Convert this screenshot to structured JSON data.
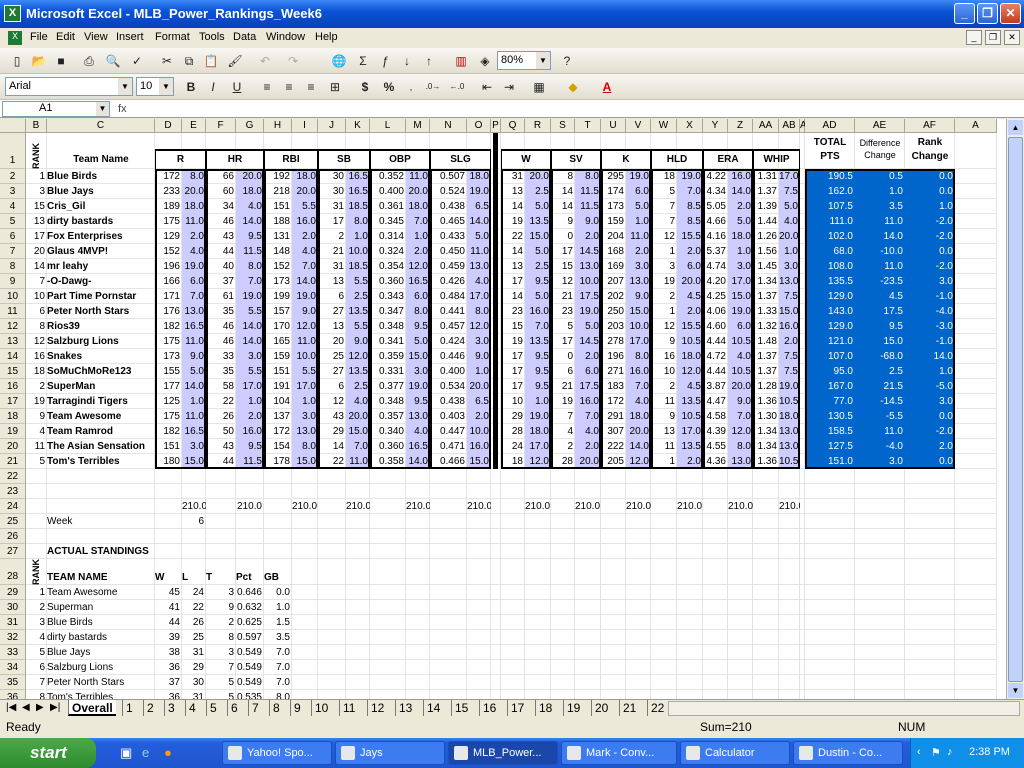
{
  "window": {
    "title": "Microsoft Excel - MLB_Power_Rankings_Week6"
  },
  "menu": [
    "File",
    "Edit",
    "View",
    "Insert",
    "Format",
    "Tools",
    "Data",
    "Window",
    "Help"
  ],
  "toolbar": {
    "zoom": "80%",
    "font": "Arial",
    "font_size": "10"
  },
  "formula": {
    "cell_ref": "A1",
    "fx": "fx",
    "content": ""
  },
  "columns": [
    "A",
    "B",
    "C",
    "D",
    "E",
    "F",
    "G",
    "H",
    "I",
    "J",
    "K",
    "L",
    "M",
    "N",
    "O",
    "P",
    "Q",
    "R",
    "S",
    "T",
    "U",
    "V",
    "W",
    "X",
    "Y",
    "Z",
    "AA",
    "AB",
    "AC",
    "AD",
    "AE",
    "AF",
    "A"
  ],
  "headers": {
    "rank": "RANK",
    "team": "Team Name",
    "cats": [
      "R",
      "HR",
      "RBI",
      "SB",
      "OBP",
      "SLG",
      "W",
      "SV",
      "K",
      "HLD",
      "ERA",
      "WHIP"
    ],
    "total": "TOTAL PTS",
    "diff": "Difference Change",
    "rank_change": "Rank Change"
  },
  "teams": [
    {
      "rank": "1",
      "name": "Blue Birds",
      "v": [
        "172",
        "8.0",
        "66",
        "20.0",
        "192",
        "18.0",
        "30",
        "16.5",
        "0.352",
        "11.0",
        "0.507",
        "18.0",
        "31",
        "20.0",
        "8",
        "8.0",
        "295",
        "19.0",
        "18",
        "19.0",
        "4.22",
        "16.0",
        "1.31",
        "17.0"
      ],
      "total": "190.5",
      "diff": "0.5",
      "rc": "0.0"
    },
    {
      "rank": "3",
      "name": "Blue Jays",
      "v": [
        "233",
        "20.0",
        "60",
        "18.0",
        "218",
        "20.0",
        "30",
        "16.5",
        "0.400",
        "20.0",
        "0.524",
        "19.0",
        "13",
        "2.5",
        "14",
        "11.5",
        "174",
        "6.0",
        "5",
        "7.0",
        "4.34",
        "14.0",
        "1.37",
        "7.5"
      ],
      "total": "162.0",
      "diff": "1.0",
      "rc": "0.0"
    },
    {
      "rank": "15",
      "name": "Cris_Gil",
      "v": [
        "189",
        "18.0",
        "34",
        "4.0",
        "151",
        "5.5",
        "31",
        "18.5",
        "0.361",
        "18.0",
        "0.438",
        "6.5",
        "14",
        "5.0",
        "14",
        "11.5",
        "173",
        "5.0",
        "7",
        "8.5",
        "5.05",
        "2.0",
        "1.39",
        "5.0"
      ],
      "total": "107.5",
      "diff": "3.5",
      "rc": "1.0"
    },
    {
      "rank": "13",
      "name": "dirty bastards",
      "v": [
        "175",
        "11.0",
        "46",
        "14.0",
        "188",
        "16.0",
        "17",
        "8.0",
        "0.345",
        "7.0",
        "0.465",
        "14.0",
        "19",
        "13.5",
        "9",
        "9.0",
        "159",
        "1.0",
        "7",
        "8.5",
        "4.66",
        "5.0",
        "1.44",
        "4.0"
      ],
      "total": "111.0",
      "diff": "11.0",
      "rc": "-2.0"
    },
    {
      "rank": "17",
      "name": "Fox Enterprises",
      "v": [
        "129",
        "2.0",
        "43",
        "9.5",
        "131",
        "2.0",
        "2",
        "1.0",
        "0.314",
        "1.0",
        "0.433",
        "5.0",
        "22",
        "15.0",
        "0",
        "2.0",
        "204",
        "11.0",
        "12",
        "15.5",
        "4.16",
        "18.0",
        "1.26",
        "20.0"
      ],
      "total": "102.0",
      "diff": "14.0",
      "rc": "-2.0"
    },
    {
      "rank": "20",
      "name": "Glaus 4MVP!",
      "v": [
        "152",
        "4.0",
        "44",
        "11.5",
        "148",
        "4.0",
        "21",
        "10.0",
        "0.324",
        "2.0",
        "0.450",
        "11.0",
        "14",
        "5.0",
        "17",
        "14.5",
        "168",
        "2.0",
        "1",
        "2.0",
        "5.37",
        "1.0",
        "1.56",
        "1.0"
      ],
      "total": "68.0",
      "diff": "-10.0",
      "rc": "0.0"
    },
    {
      "rank": "14",
      "name": "mr leahy",
      "v": [
        "196",
        "19.0",
        "40",
        "8.0",
        "152",
        "7.0",
        "31",
        "18.5",
        "0.354",
        "12.0",
        "0.459",
        "13.0",
        "13",
        "2.5",
        "15",
        "13.0",
        "169",
        "3.0",
        "3",
        "6.0",
        "4.74",
        "3.0",
        "1.45",
        "3.0"
      ],
      "total": "108.0",
      "diff": "11.0",
      "rc": "-2.0"
    },
    {
      "rank": "7",
      "name": "-O-Dawg-",
      "v": [
        "166",
        "6.0",
        "37",
        "7.0",
        "173",
        "14.0",
        "13",
        "5.5",
        "0.360",
        "16.5",
        "0.426",
        "4.0",
        "17",
        "9.5",
        "12",
        "10.0",
        "207",
        "13.0",
        "19",
        "20.0",
        "4.20",
        "17.0",
        "1.34",
        "13.0"
      ],
      "total": "135.5",
      "diff": "-23.5",
      "rc": "3.0"
    },
    {
      "rank": "10",
      "name": "Part Time Pornstar",
      "v": [
        "171",
        "7.0",
        "61",
        "19.0",
        "199",
        "19.0",
        "6",
        "2.5",
        "0.343",
        "6.0",
        "0.484",
        "17.0",
        "14",
        "5.0",
        "21",
        "17.5",
        "202",
        "9.0",
        "2",
        "4.5",
        "4.25",
        "15.0",
        "1.37",
        "7.5"
      ],
      "total": "129.0",
      "diff": "4.5",
      "rc": "-1.0"
    },
    {
      "rank": "6",
      "name": "Peter North Stars",
      "v": [
        "176",
        "13.0",
        "35",
        "5.5",
        "157",
        "9.0",
        "27",
        "13.5",
        "0.347",
        "8.0",
        "0.441",
        "8.0",
        "23",
        "16.0",
        "23",
        "19.0",
        "250",
        "15.0",
        "1",
        "2.0",
        "4.06",
        "19.0",
        "1.33",
        "15.0"
      ],
      "total": "143.0",
      "diff": "17.5",
      "rc": "-4.0"
    },
    {
      "rank": "8",
      "name": "Rios39",
      "v": [
        "182",
        "16.5",
        "46",
        "14.0",
        "170",
        "12.0",
        "13",
        "5.5",
        "0.348",
        "9.5",
        "0.457",
        "12.0",
        "15",
        "7.0",
        "5",
        "5.0",
        "203",
        "10.0",
        "12",
        "15.5",
        "4.60",
        "6.0",
        "1.32",
        "16.0"
      ],
      "total": "129.0",
      "diff": "9.5",
      "rc": "-3.0"
    },
    {
      "rank": "12",
      "name": "Salzburg Lions",
      "v": [
        "175",
        "11.0",
        "46",
        "14.0",
        "165",
        "11.0",
        "20",
        "9.0",
        "0.341",
        "5.0",
        "0.424",
        "3.0",
        "19",
        "13.5",
        "17",
        "14.5",
        "278",
        "17.0",
        "9",
        "10.5",
        "4.44",
        "10.5",
        "1.48",
        "2.0"
      ],
      "total": "121.0",
      "diff": "15.0",
      "rc": "-1.0"
    },
    {
      "rank": "16",
      "name": "Snakes",
      "v": [
        "173",
        "9.0",
        "33",
        "3.0",
        "159",
        "10.0",
        "25",
        "12.0",
        "0.359",
        "15.0",
        "0.446",
        "9.0",
        "17",
        "9.5",
        "0",
        "2.0",
        "196",
        "8.0",
        "16",
        "18.0",
        "4.72",
        "4.0",
        "1.37",
        "7.5"
      ],
      "total": "107.0",
      "diff": "-68.0",
      "rc": "14.0"
    },
    {
      "rank": "18",
      "name": "SoMuChMoRe123",
      "v": [
        "155",
        "5.0",
        "35",
        "5.5",
        "151",
        "5.5",
        "27",
        "13.5",
        "0.331",
        "3.0",
        "0.400",
        "1.0",
        "17",
        "9.5",
        "6",
        "6.0",
        "271",
        "16.0",
        "10",
        "12.0",
        "4.44",
        "10.5",
        "1.37",
        "7.5"
      ],
      "total": "95.0",
      "diff": "2.5",
      "rc": "1.0"
    },
    {
      "rank": "2",
      "name": "SuperMan",
      "v": [
        "177",
        "14.0",
        "58",
        "17.0",
        "191",
        "17.0",
        "6",
        "2.5",
        "0.377",
        "19.0",
        "0.534",
        "20.0",
        "17",
        "9.5",
        "21",
        "17.5",
        "183",
        "7.0",
        "2",
        "4.5",
        "3.87",
        "20.0",
        "1.28",
        "19.0"
      ],
      "total": "167.0",
      "diff": "21.5",
      "rc": "-5.0"
    },
    {
      "rank": "19",
      "name": "Tarragindi Tigers",
      "v": [
        "125",
        "1.0",
        "22",
        "1.0",
        "104",
        "1.0",
        "12",
        "4.0",
        "0.348",
        "9.5",
        "0.438",
        "6.5",
        "10",
        "1.0",
        "19",
        "16.0",
        "172",
        "4.0",
        "11",
        "13.5",
        "4.47",
        "9.0",
        "1.36",
        "10.5"
      ],
      "total": "77.0",
      "diff": "-14.5",
      "rc": "3.0"
    },
    {
      "rank": "9",
      "name": "Team Awesome",
      "v": [
        "175",
        "11.0",
        "26",
        "2.0",
        "137",
        "3.0",
        "43",
        "20.0",
        "0.357",
        "13.0",
        "0.403",
        "2.0",
        "29",
        "19.0",
        "7",
        "7.0",
        "291",
        "18.0",
        "9",
        "10.5",
        "4.58",
        "7.0",
        "1.30",
        "18.0"
      ],
      "total": "130.5",
      "diff": "-5.5",
      "rc": "0.0"
    },
    {
      "rank": "4",
      "name": "Team Ramrod",
      "v": [
        "182",
        "16.5",
        "50",
        "16.0",
        "172",
        "13.0",
        "29",
        "15.0",
        "0.340",
        "4.0",
        "0.447",
        "10.0",
        "28",
        "18.0",
        "4",
        "4.0",
        "307",
        "20.0",
        "13",
        "17.0",
        "4.39",
        "12.0",
        "1.34",
        "13.0"
      ],
      "total": "158.5",
      "diff": "11.0",
      "rc": "-2.0"
    },
    {
      "rank": "11",
      "name": "The Asian Sensation",
      "v": [
        "151",
        "3.0",
        "43",
        "9.5",
        "154",
        "8.0",
        "14",
        "7.0",
        "0.360",
        "16.5",
        "0.471",
        "16.0",
        "24",
        "17.0",
        "2",
        "2.0",
        "222",
        "14.0",
        "11",
        "13.5",
        "4.55",
        "8.0",
        "1.34",
        "13.0"
      ],
      "total": "127.5",
      "diff": "-4.0",
      "rc": "2.0"
    },
    {
      "rank": "5",
      "name": "Tom's Terribles",
      "v": [
        "180",
        "15.0",
        "44",
        "11.5",
        "178",
        "15.0",
        "22",
        "11.0",
        "0.358",
        "14.0",
        "0.466",
        "15.0",
        "18",
        "12.0",
        "28",
        "20.0",
        "205",
        "12.0",
        "1",
        "2.0",
        "4.36",
        "13.0",
        "1.36",
        "10.5"
      ],
      "total": "151.0",
      "diff": "3.0",
      "rc": "0.0"
    }
  ],
  "sum_row": [
    "210.0",
    "210.0",
    "210.0",
    "210.0",
    "210.0",
    "210.0",
    "210.0",
    "210.0",
    "210.0",
    "210.0",
    "210.0",
    "210.0"
  ],
  "week": {
    "label": "Week",
    "value": "6"
  },
  "standings": {
    "title": "ACTUAL STANDINGS",
    "rank_label": "RANK",
    "cols": [
      "TEAM NAME",
      "W",
      "L",
      "T",
      "Pct",
      "GB"
    ],
    "rows": [
      [
        "1",
        "Team Awesome",
        "45",
        "24",
        "3",
        "0.646",
        "0.0"
      ],
      [
        "2",
        "Superman",
        "41",
        "22",
        "9",
        "0.632",
        "1.0"
      ],
      [
        "3",
        "Blue Birds",
        "44",
        "26",
        "2",
        "0.625",
        "1.5"
      ],
      [
        "4",
        "dirty bastards",
        "39",
        "25",
        "8",
        "0.597",
        "3.5"
      ],
      [
        "5",
        "Blue Jays",
        "38",
        "31",
        "3",
        "0.549",
        "7.0"
      ],
      [
        "6",
        "Salzburg Lions",
        "36",
        "29",
        "7",
        "0.549",
        "7.0"
      ],
      [
        "7",
        "Peter North Stars",
        "37",
        "30",
        "5",
        "0.549",
        "7.0"
      ],
      [
        "8",
        "Tom's Terribles",
        "36",
        "31",
        "5",
        "0.535",
        "8.0"
      ]
    ]
  },
  "sheet_tabs": [
    "Overall",
    "1",
    "2",
    "3",
    "4",
    "5",
    "6",
    "7",
    "8",
    "9",
    "10",
    "11",
    "12",
    "13",
    "14",
    "15",
    "16",
    "17",
    "18",
    "19",
    "20",
    "21",
    "22"
  ],
  "status": {
    "ready": "Ready",
    "sum": "Sum=210",
    "num": "NUM"
  },
  "taskbar": {
    "start": "start",
    "tasks": [
      "Yahoo! Spo...",
      "Jays",
      "MLB_Power...",
      "Mark - Conv...",
      "Calculator",
      "Dustin - Co..."
    ],
    "clock": "2:38 PM"
  }
}
